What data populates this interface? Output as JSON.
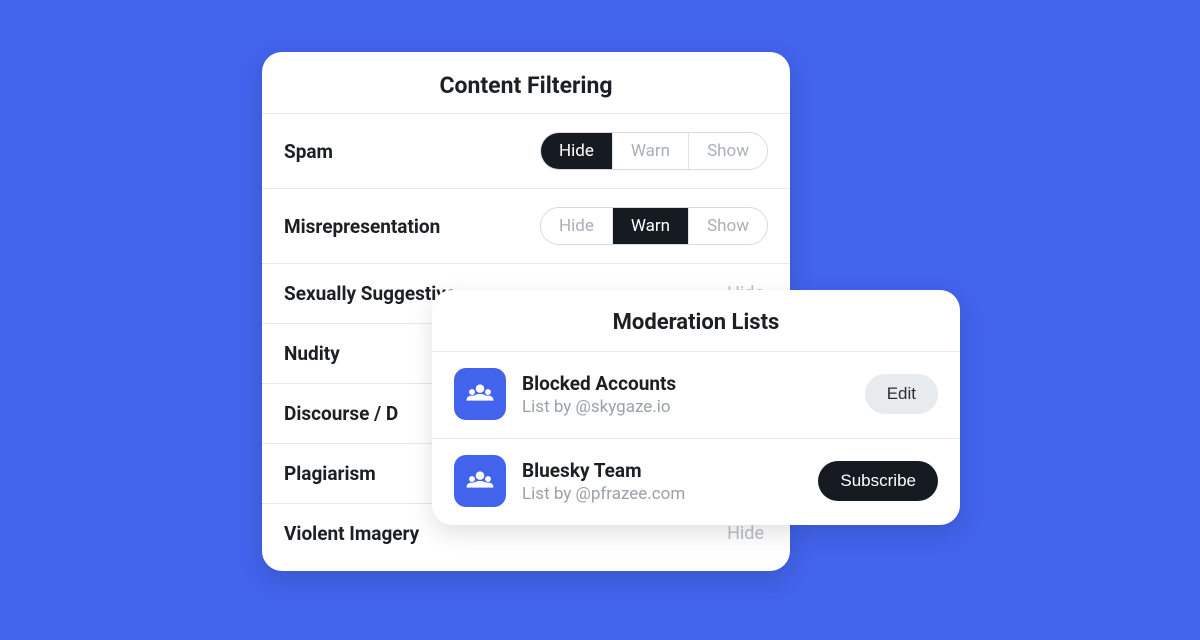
{
  "filtering": {
    "title": "Content Filtering",
    "options": {
      "hide": "Hide",
      "warn": "Warn",
      "show": "Show"
    },
    "rows": [
      {
        "label": "Spam",
        "selected": "Hide"
      },
      {
        "label": "Misrepresentation",
        "selected": "Warn"
      },
      {
        "label": "Sexually Suggestive",
        "faded": "Hide"
      },
      {
        "label": "Nudity"
      },
      {
        "label": "Discourse / D"
      },
      {
        "label": "Plagiarism"
      },
      {
        "label": "Violent Imagery",
        "faded": "Hide"
      }
    ]
  },
  "moderation": {
    "title": "Moderation Lists",
    "rows": [
      {
        "name": "Blocked Accounts",
        "sub": "List by @skygaze.io",
        "action": "Edit",
        "style": "light"
      },
      {
        "name": "Bluesky Team",
        "sub": "List by @pfrazee.com",
        "action": "Subscribe",
        "style": "dark"
      }
    ]
  }
}
